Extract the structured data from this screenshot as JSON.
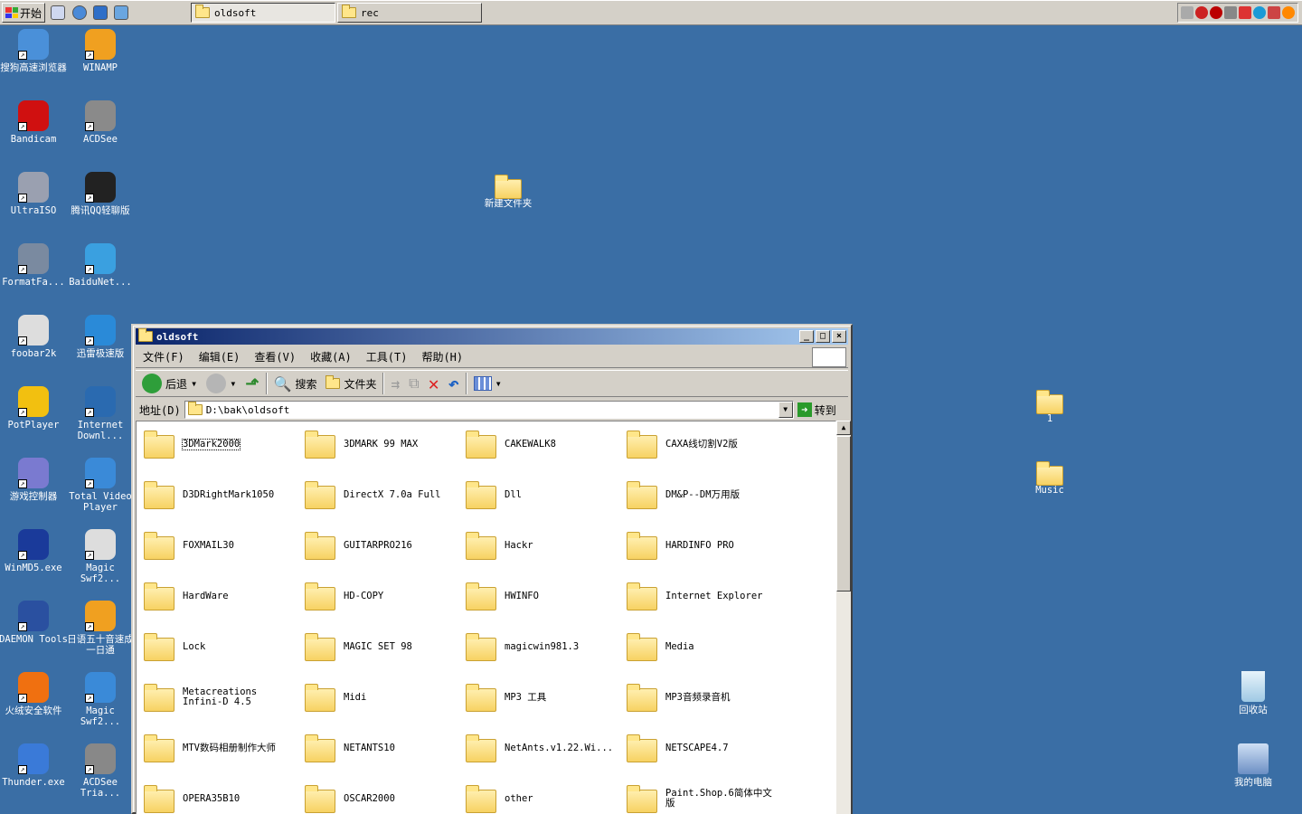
{
  "taskbar": {
    "start_label": "开始",
    "tasks": [
      {
        "label": "oldsoft",
        "active": true
      },
      {
        "label": "rec",
        "active": false
      }
    ]
  },
  "desktop_icons": [
    {
      "label": "搜狗高速浏览器",
      "icon": "sogou-browser-icon"
    },
    {
      "label": "WINAMP",
      "icon": "winamp-icon"
    },
    {
      "label": "Bandicam",
      "icon": "bandicam-icon"
    },
    {
      "label": "ACDSee",
      "icon": "acdsee-icon"
    },
    {
      "label": "UltraISO",
      "icon": "ultraiso-icon"
    },
    {
      "label": "腾讯QQ轻聊版",
      "icon": "qq-icon"
    },
    {
      "label": "FormatFa...",
      "icon": "format-factory-icon"
    },
    {
      "label": "BaiduNet...",
      "icon": "baidu-netdisk-icon"
    },
    {
      "label": "foobar2k",
      "icon": "foobar-icon"
    },
    {
      "label": "迅雷极速版",
      "icon": "xunlei-icon"
    },
    {
      "label": "PotPlayer",
      "icon": "potplayer-icon"
    },
    {
      "label": "Internet Downl...",
      "icon": "idm-icon"
    },
    {
      "label": "游戏控制器",
      "icon": "game-controller-icon"
    },
    {
      "label": "Total Video Player",
      "icon": "total-video-player-icon"
    },
    {
      "label": "WinMD5.exe",
      "icon": "winmd5-icon"
    },
    {
      "label": "Magic Swf2...",
      "icon": "magic-swf-icon"
    },
    {
      "label": "DAEMON Tools",
      "icon": "daemon-tools-icon"
    },
    {
      "label": "日语五十音速成一日通",
      "icon": "japanese-app-icon"
    },
    {
      "label": "火绒安全软件",
      "icon": "huorong-icon"
    },
    {
      "label": "Magic Swf2...",
      "icon": "magic-swf2-icon"
    },
    {
      "label": "Thunder.exe",
      "icon": "thunder-icon"
    },
    {
      "label": "ACDSee Tria...",
      "icon": "acdsee-trial-icon"
    }
  ],
  "desktop_folders": [
    {
      "label": "新建文件夹"
    },
    {
      "label": "1"
    },
    {
      "label": "Music"
    }
  ],
  "desktop_right": [
    {
      "label": "回收站",
      "icon": "recycle-bin-icon"
    },
    {
      "label": "我的电脑",
      "icon": "my-computer-icon"
    }
  ],
  "window": {
    "title": "oldsoft",
    "menu": [
      "文件(F)",
      "编辑(E)",
      "查看(V)",
      "收藏(A)",
      "工具(T)",
      "帮助(H)"
    ],
    "toolbar": {
      "back": "后退",
      "search": "搜索",
      "folders": "文件夹"
    },
    "address_label": "地址(D)",
    "address": "D:\\bak\\oldsoft",
    "go_label": "转到",
    "items": [
      "3DMark2000",
      "3DMARK 99 MAX",
      "CAKEWALK8",
      "CAXA线切割V2版",
      "D3DRightMark1050",
      "DirectX 7.0a Full",
      "Dll",
      "DM&P--DM万用版",
      "FOXMAIL30",
      "GUITARPRO216",
      "Hackr",
      "HARDINFO PRO",
      "HardWare",
      "HD-COPY",
      "HWINFO",
      "Internet Explorer",
      "Lock",
      "MAGIC SET 98",
      "magicwin981.3",
      "Media",
      "Metacreations Infini-D 4.5",
      "Midi",
      "MP3 工具",
      "MP3音频录音机",
      "MTV数码相册制作大师",
      "NETANTS10",
      "NetAnts.v1.22.Wi...",
      "NETSCAPE4.7",
      "OPERA35B10",
      "OSCAR2000",
      "other",
      "Paint.Shop.6简体中文版"
    ]
  },
  "colors": {
    "desktop": "#3a6ea5",
    "title_start": "#0a246a",
    "title_end": "#a6caf0"
  }
}
